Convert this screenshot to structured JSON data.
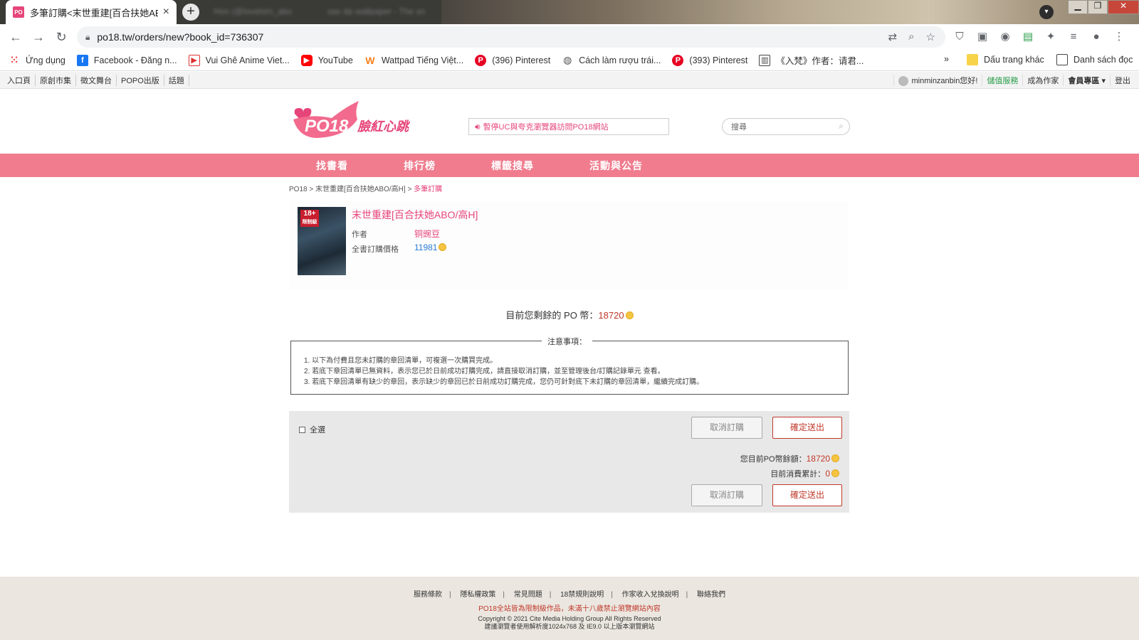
{
  "browser": {
    "tab_title": "多筆訂購<末世重建[百合扶她ABO",
    "background_tab_1": "Hon (@lovelorn_abo",
    "background_tab_2": "sax da wallpaper - The sn",
    "url": "po18.tw/orders/new?book_id=736307"
  },
  "bookmarks": {
    "items": [
      "Ứng dụng",
      "Facebook - Đăng n...",
      "Vui Ghê Anime Viet...",
      "YouTube",
      "Wattpad Tiếng Việt...",
      "(396) Pinterest",
      "Cách làm rượu trái...",
      "(393) Pinterest",
      "《入梵》作者：请君..."
    ],
    "overflow": "»",
    "other_bookmarks": "Dấu trang khác",
    "reading_list": "Danh sách đọc"
  },
  "sitebar": {
    "left": [
      "入口頁",
      "原創市集",
      "徵文舞台",
      "POPO出版",
      "話題"
    ],
    "greeting": "minminzanbin您好!",
    "service": "儲值服務",
    "become_author": "成為作家",
    "member": "會員專區",
    "logout": "登出"
  },
  "header": {
    "logo_text": "PO18",
    "logo_tagline": "臉紅心跳",
    "notice": "暫停UC與夸克瀏覽器訪問PO18網站",
    "search_placeholder": "搜尋"
  },
  "mainnav": [
    "找書看",
    "排行榜",
    "標籤搜尋",
    "活動與公告"
  ],
  "breadcrumb": {
    "home": "PO18",
    "sep1": ">",
    "book": "末世重建[百合扶她ABO/高H]",
    "sep2": ">",
    "current": "多筆訂購"
  },
  "book": {
    "cover_badge": "18+",
    "cover_badge_sub": "限制級",
    "title": "末世重建[百合扶她ABO/高H]",
    "author_label": "作者",
    "author": "铜豌豆",
    "price_label": "全書訂購價格",
    "price": "11981"
  },
  "balance": {
    "label": "目前您剩餘的 PO 幣：",
    "value": "18720"
  },
  "notes": {
    "legend": "注意事項：",
    "items": [
      "1. 以下為付費且您未訂購的章回清單，可複選一次購買完成。",
      "2. 若底下章回清單已無資料，表示您已於日前成功訂購完成，請直接取消訂購，並至管理後台/訂購記錄單元 查看。",
      "3. 若底下章回清單有缺少的章回，表示缺少的章回已於日前成功訂購完成，您仍可針對底下未訂購的章回清單，繼續完成訂購。"
    ]
  },
  "order": {
    "select_all": "全選",
    "cancel": "取消訂購",
    "confirm": "確定送出",
    "balance_label": "您目前PO幣餘額：",
    "balance_value": "18720",
    "total_label": "目前消費累計：",
    "total_value": "0"
  },
  "footer": {
    "links": [
      "服務條款",
      "隱私權政策",
      "常見問題",
      "18禁規則說明",
      "作家收入兌換說明",
      "聯絡我們"
    ],
    "warning": "PO18全站皆為限制級作品，未滿十八歲禁止瀏覽網站內容",
    "copyright": "Copyright © 2021 Cite Media Holding Group All Rights Reserved",
    "resolution": "建議瀏覽者使用解析度1024x768 及 IE9.0 以上版本瀏覽網站"
  },
  "colors": {
    "brand_pink": "#e6457a",
    "nav_pink": "#f07c8e",
    "price_red": "#c0392b",
    "link_blue": "#2b7bd6"
  }
}
